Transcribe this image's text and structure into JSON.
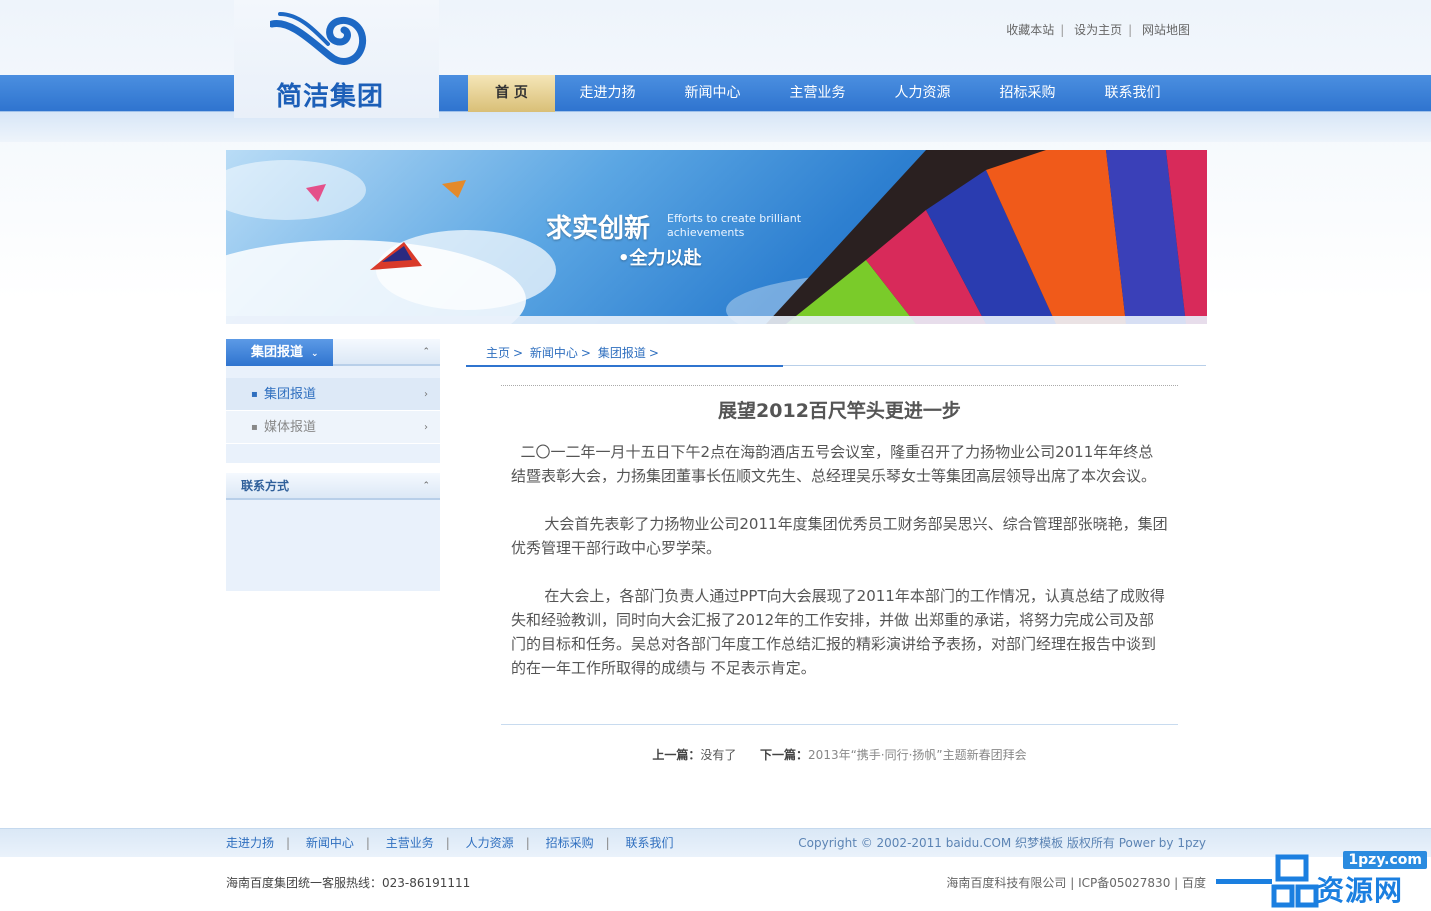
{
  "top_links": [
    "收藏本站",
    "设为主页",
    "网站地图"
  ],
  "logo": {
    "text": "简洁集团"
  },
  "nav": [
    "首 页",
    "走进力扬",
    "新闻中心",
    "主营业务",
    "人力资源",
    "招标采购",
    "联系我们"
  ],
  "banner": {
    "main": "求实创新",
    "sub": "Efforts to create brilliant achievements",
    "line2": "•全力以赴"
  },
  "sidebar": {
    "news_title": "集团报道",
    "news_items": [
      "集团报道",
      "媒体报道"
    ],
    "contact_title": "联系方式"
  },
  "breadcrumb": [
    "主页",
    "新闻中心",
    "集团报道"
  ],
  "article": {
    "title": "展望2012百尺竿头更进一步",
    "paragraphs": [
      "  二〇一二年一月十五日下午2点在海韵酒店五号会议室，隆重召开了力扬物业公司2011年年终总结暨表彰大会，力扬集团董事长伍顺文先生、总经理吴乐琴女士等集团高层领导出席了本次会议。",
      "       大会首先表彰了力扬物业公司2011年度集团优秀员工财务部吴思兴、综合管理部张晓艳，集团优秀管理干部行政中心罗学荣。",
      "       在大会上，各部门负责人通过PPT向大会展现了2011年本部门的工作情况，认真总结了成败得失和经验教训，同时向大会汇报了2012年的工作安排，并做 出郑重的承诺，将努力完成公司及部门的目标和任务。吴总对各部门年度工作总结汇报的精彩演讲给予表扬，对部门经理在报告中谈到的在一年工作所取得的成绩与 不足表示肯定。"
    ],
    "prev_label": "上一篇：",
    "prev_value": "没有了",
    "next_label": "下一篇：",
    "next_value": "2013年“携手·同行·扬帆”主题新春团拜会"
  },
  "footer": {
    "links": [
      "走进力扬",
      "新闻中心",
      "主营业务",
      "人力资源",
      "招标采购",
      "联系我们"
    ],
    "copyright": "Copyright © 2002-2011 baidu.COM 织梦模板 版权所有 Power by 1pzy",
    "hotline": "海南百度集团统一客服热线：023-86191111",
    "icp": "海南百度科技有限公司 | ICP备05027830 | 百度"
  },
  "watermark": {
    "domain": "1pzy.com",
    "text": "资源网"
  },
  "colors": {
    "nav_blue": "#2f74cf",
    "active_gold": "#d9bf77",
    "link_blue": "#2f6fbf"
  }
}
